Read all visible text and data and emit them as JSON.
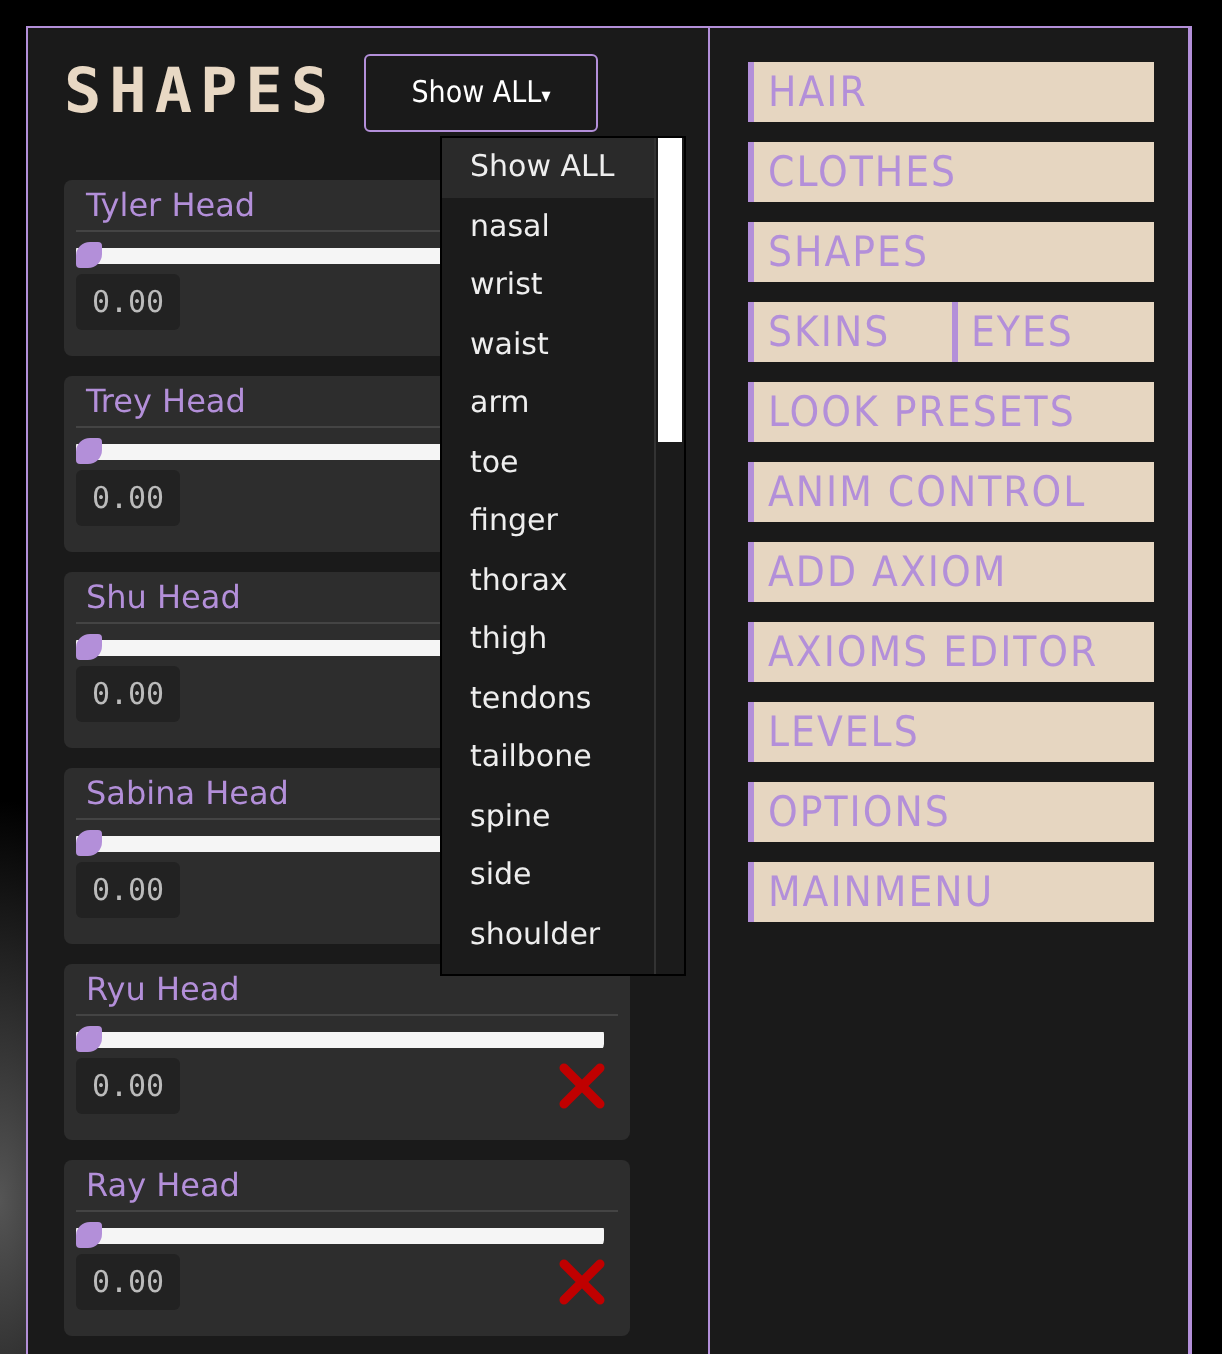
{
  "panel": {
    "title": "SHAPES",
    "filter": {
      "value": "Show ALL",
      "expanded": true,
      "caret": "▾"
    }
  },
  "filter_options": [
    {
      "label": "Show ALL",
      "selected": true
    },
    {
      "label": "nasal",
      "selected": false
    },
    {
      "label": "wrist",
      "selected": false
    },
    {
      "label": "waist",
      "selected": false
    },
    {
      "label": "arm",
      "selected": false
    },
    {
      "label": "toe",
      "selected": false
    },
    {
      "label": "finger",
      "selected": false
    },
    {
      "label": "thorax",
      "selected": false
    },
    {
      "label": "thigh",
      "selected": false
    },
    {
      "label": "tendons",
      "selected": false
    },
    {
      "label": "tailbone",
      "selected": false
    },
    {
      "label": "spine",
      "selected": false
    },
    {
      "label": "side",
      "selected": false
    },
    {
      "label": "shoulder",
      "selected": false
    }
  ],
  "shapes": [
    {
      "name": "Tyler Head",
      "level": 0,
      "value": "0.00",
      "remove_visible": false
    },
    {
      "name": "Trey Head",
      "level": 0,
      "value": "0.00",
      "remove_visible": false
    },
    {
      "name": "Shu Head",
      "level": 0,
      "value": "0.00",
      "remove_visible": false
    },
    {
      "name": "Sabina Head",
      "level": 0,
      "value": "0.00",
      "remove_visible": false
    },
    {
      "name": "Ryu Head",
      "level": 0,
      "value": "0.00",
      "remove_visible": true
    },
    {
      "name": "Ray Head",
      "level": 0,
      "value": "0.00",
      "remove_visible": true
    }
  ],
  "menu": [
    [
      "HAIR"
    ],
    [
      "CLOTHES"
    ],
    [
      "SHAPES"
    ],
    [
      "SKINS",
      "EYES"
    ],
    [
      "LOOK PRESETS"
    ],
    [
      "ANIM CONTROL"
    ],
    [
      "ADD AXIOM"
    ],
    [
      "AXIOMS EDITOR"
    ],
    [
      "LEVELS"
    ],
    [
      "OPTIONS"
    ],
    [
      "MAINMENU"
    ]
  ]
}
